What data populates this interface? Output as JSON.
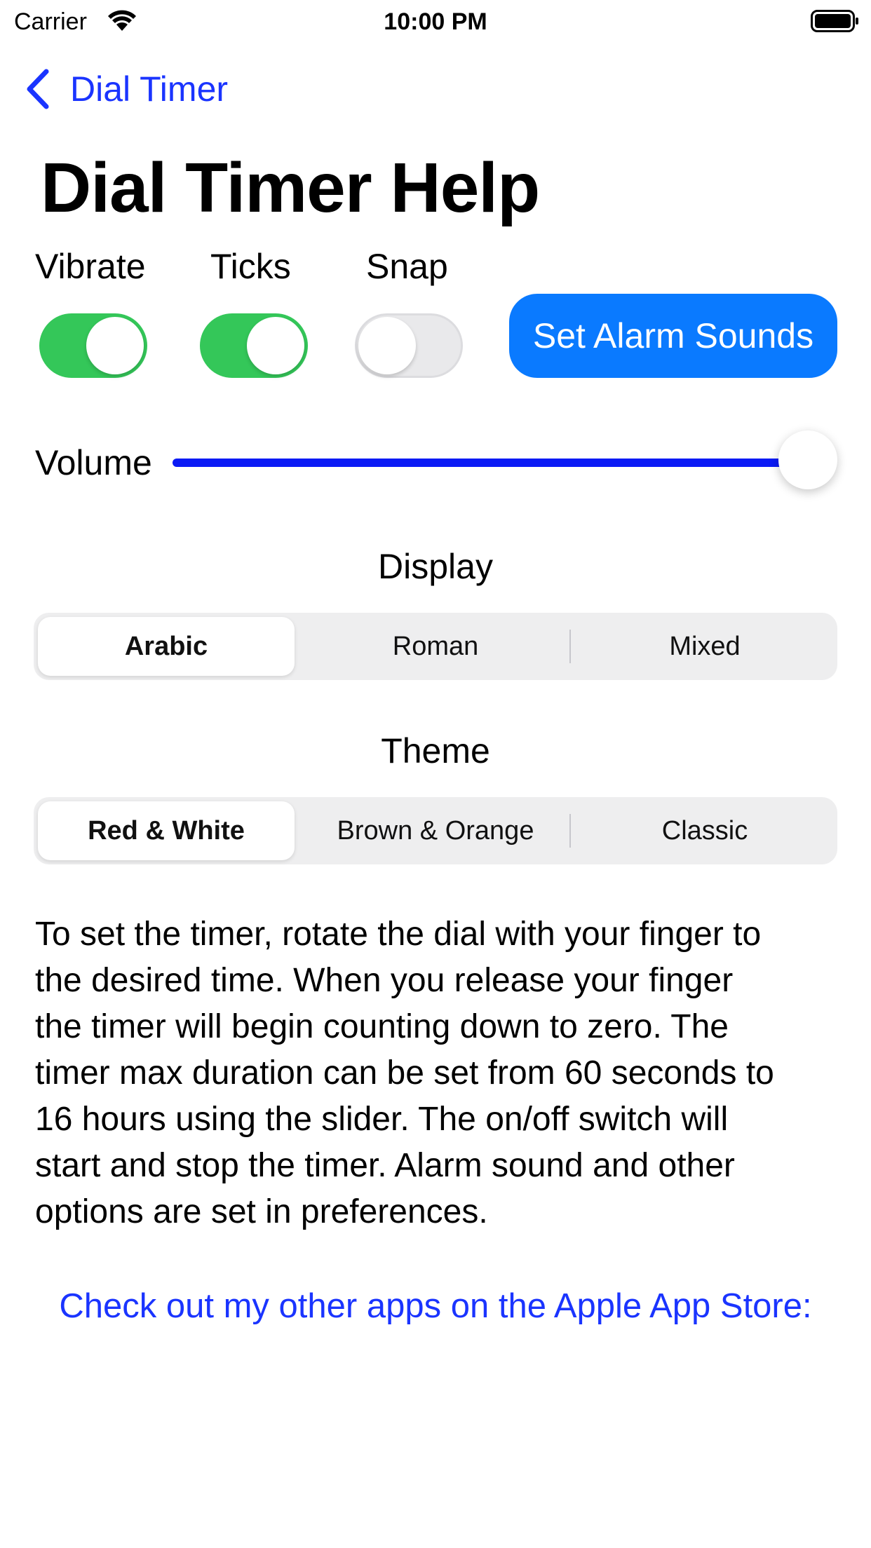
{
  "status_bar": {
    "carrier": "Carrier",
    "time": "10:00 PM",
    "wifi_icon": "wifi-icon",
    "battery_icon": "battery-full-icon"
  },
  "nav": {
    "back_label": "Dial Timer",
    "back_icon": "chevron-left-icon",
    "accent_color": "#1a34ff"
  },
  "page": {
    "title": "Dial Timer Help"
  },
  "toggles": [
    {
      "label": "Vibrate",
      "on": true
    },
    {
      "label": "Ticks",
      "on": true
    },
    {
      "label": "Snap",
      "on": false
    }
  ],
  "alarm_button": {
    "label": "Set Alarm Sounds",
    "color": "#0a7aff"
  },
  "volume": {
    "label": "Volume",
    "value": 1.0,
    "track_color": "#0a1af5"
  },
  "display": {
    "title": "Display",
    "options": [
      "Arabic",
      "Roman",
      "Mixed"
    ],
    "selected": "Arabic"
  },
  "theme": {
    "title": "Theme",
    "options": [
      "Red & White",
      "Brown & Orange",
      "Classic"
    ],
    "selected": "Red & White"
  },
  "help_text": "To set the timer, rotate the dial with your finger to\nthe desired time.  When you release your finger\nthe timer will begin counting down to zero.  The\ntimer max duration can be set from 60 seconds to\n16 hours using the slider.  The on/off switch will\nstart and stop the timer.  Alarm sound and other\noptions are set in preferences.",
  "store_link": "Check out my other apps on the Apple App Store:"
}
